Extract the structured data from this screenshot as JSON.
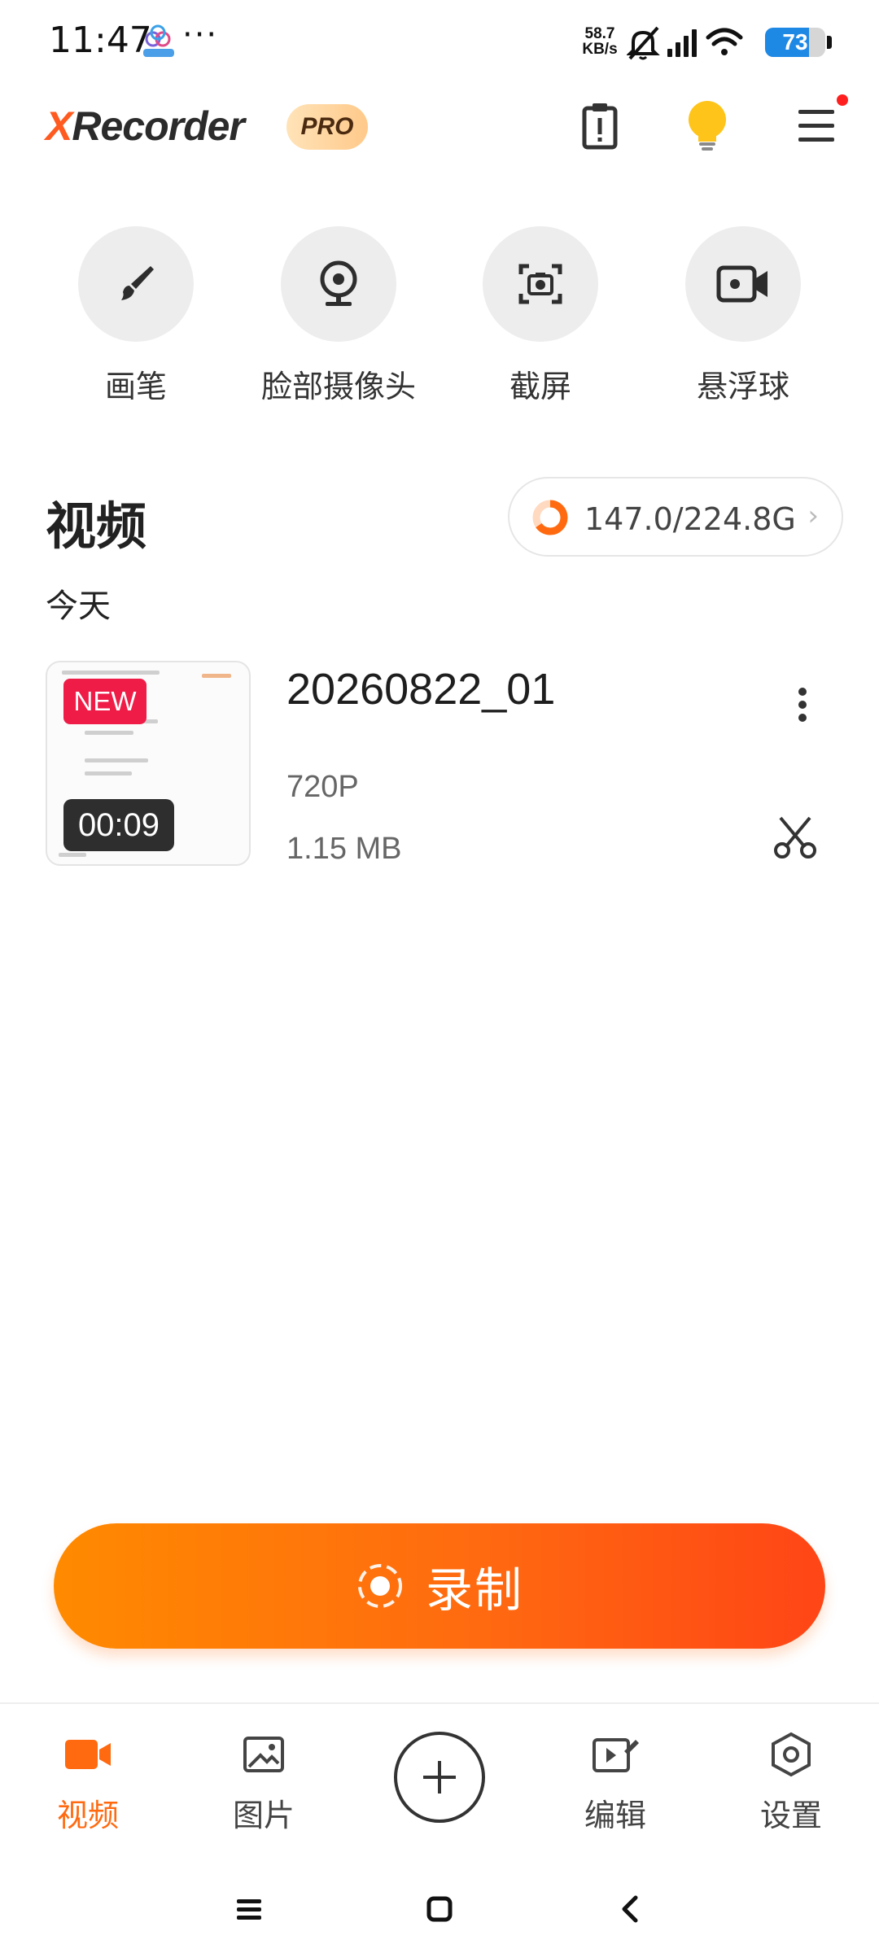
{
  "status_bar": {
    "time": "11:47",
    "dots": "···",
    "net_speed_value": "58.7",
    "net_speed_unit": "KB/s",
    "battery_level": "73",
    "battery_fraction": 0.73
  },
  "header": {
    "logo_x": "X",
    "logo_rest": "Recorder",
    "pro_badge": "PRO",
    "icons": [
      "clipboard-alert-icon",
      "lightbulb-icon",
      "menu-icon"
    ],
    "menu_has_notification": true
  },
  "tools": [
    {
      "label": "画笔",
      "icon": "brush-icon"
    },
    {
      "label": "脸部摄像头",
      "icon": "webcam-icon"
    },
    {
      "label": "截屏",
      "icon": "screenshot-icon"
    },
    {
      "label": "悬浮球",
      "icon": "video-camera-icon"
    }
  ],
  "videos": {
    "title": "视频",
    "storage": "147.0/224.8G",
    "storage_used_fraction": 0.654,
    "day_label": "今天",
    "items": [
      {
        "name": "20260822_01",
        "badge": "NEW",
        "duration": "00:09",
        "resolution": "720P",
        "size": "1.15 MB"
      }
    ]
  },
  "record_button": {
    "label": "录制"
  },
  "bottom_nav": {
    "items": [
      {
        "label": "视频",
        "icon": "video-icon",
        "active": true
      },
      {
        "label": "图片",
        "icon": "image-icon",
        "active": false
      },
      {
        "label": "编辑",
        "icon": "edit-video-icon",
        "active": false
      },
      {
        "label": "设置",
        "icon": "settings-icon",
        "active": false
      }
    ],
    "add_icon": "plus-circle-icon"
  },
  "colors": {
    "accent": "#ff6a10",
    "new_badge": "#ee1c47",
    "battery": "#1e88e5"
  }
}
